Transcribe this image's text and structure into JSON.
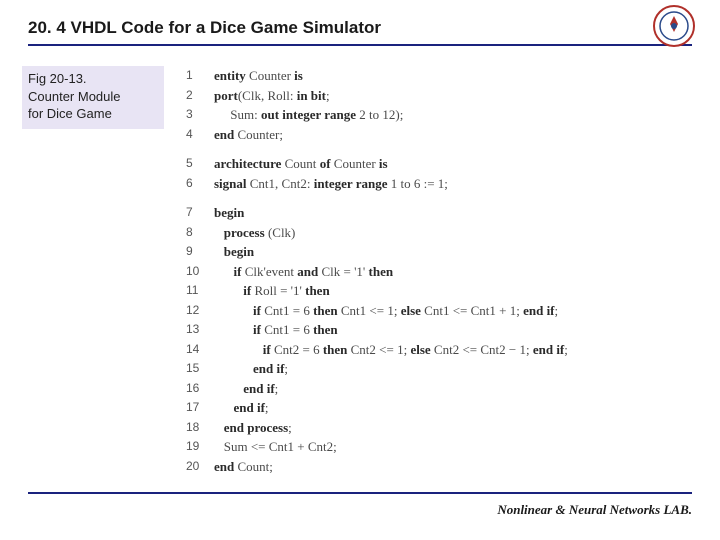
{
  "title": "20. 4 VHDL Code for a Dice Game Simulator",
  "caption": {
    "line1": "Fig 20-13.",
    "line2": "Counter Module",
    "line3": "for Dice Game"
  },
  "code": [
    {
      "n": "1",
      "segs": [
        {
          "t": "entity ",
          "b": true
        },
        {
          "t": "Counter "
        },
        {
          "t": "is",
          "b": true
        }
      ]
    },
    {
      "n": "2",
      "segs": [
        {
          "t": "port",
          "b": true
        },
        {
          "t": "(Clk, Roll: "
        },
        {
          "t": "in bit",
          "b": true
        },
        {
          "t": ";"
        }
      ]
    },
    {
      "n": "3",
      "segs": [
        {
          "t": "     Sum: "
        },
        {
          "t": "out integer range ",
          "b": true
        },
        {
          "t": "2 to 12);"
        }
      ]
    },
    {
      "n": "4",
      "segs": [
        {
          "t": "end ",
          "b": true
        },
        {
          "t": "Counter;"
        }
      ]
    },
    {
      "gap": true
    },
    {
      "n": "5",
      "segs": [
        {
          "t": "architecture ",
          "b": true
        },
        {
          "t": "Count "
        },
        {
          "t": "of ",
          "b": true
        },
        {
          "t": "Counter "
        },
        {
          "t": "is",
          "b": true
        }
      ]
    },
    {
      "n": "6",
      "segs": [
        {
          "t": "signal ",
          "b": true
        },
        {
          "t": "Cnt1, Cnt2: "
        },
        {
          "t": "integer range ",
          "b": true
        },
        {
          "t": "1 to 6 := 1;"
        }
      ]
    },
    {
      "gap": true
    },
    {
      "n": "7",
      "segs": [
        {
          "t": "begin",
          "b": true
        }
      ]
    },
    {
      "n": "8",
      "segs": [
        {
          "t": "   "
        },
        {
          "t": "process ",
          "b": true
        },
        {
          "t": "(Clk)"
        }
      ]
    },
    {
      "n": "9",
      "segs": [
        {
          "t": "   "
        },
        {
          "t": "begin",
          "b": true
        }
      ]
    },
    {
      "n": "10",
      "segs": [
        {
          "t": "      "
        },
        {
          "t": "if ",
          "b": true
        },
        {
          "t": "Clk'event "
        },
        {
          "t": "and ",
          "b": true
        },
        {
          "t": "Clk = '1' "
        },
        {
          "t": "then",
          "b": true
        }
      ]
    },
    {
      "n": "11",
      "segs": [
        {
          "t": "         "
        },
        {
          "t": "if ",
          "b": true
        },
        {
          "t": "Roll = '1' "
        },
        {
          "t": "then",
          "b": true
        }
      ]
    },
    {
      "n": "12",
      "segs": [
        {
          "t": "            "
        },
        {
          "t": "if ",
          "b": true
        },
        {
          "t": "Cnt1 = 6 "
        },
        {
          "t": "then ",
          "b": true
        },
        {
          "t": "Cnt1 <= 1; "
        },
        {
          "t": "else ",
          "b": true
        },
        {
          "t": "Cnt1 <= Cnt1 + 1; "
        },
        {
          "t": "end if",
          "b": true
        },
        {
          "t": ";"
        }
      ]
    },
    {
      "n": "13",
      "segs": [
        {
          "t": "            "
        },
        {
          "t": "if ",
          "b": true
        },
        {
          "t": "Cnt1 = 6 "
        },
        {
          "t": "then",
          "b": true
        }
      ]
    },
    {
      "n": "14",
      "segs": [
        {
          "t": "               "
        },
        {
          "t": "if ",
          "b": true
        },
        {
          "t": "Cnt2 = 6 "
        },
        {
          "t": "then ",
          "b": true
        },
        {
          "t": "Cnt2 <= 1; "
        },
        {
          "t": "else ",
          "b": true
        },
        {
          "t": "Cnt2 <= Cnt2 − 1; "
        },
        {
          "t": "end if",
          "b": true
        },
        {
          "t": ";"
        }
      ]
    },
    {
      "n": "15",
      "segs": [
        {
          "t": "            "
        },
        {
          "t": "end if",
          "b": true
        },
        {
          "t": ";"
        }
      ]
    },
    {
      "n": "16",
      "segs": [
        {
          "t": "         "
        },
        {
          "t": "end if",
          "b": true
        },
        {
          "t": ";"
        }
      ]
    },
    {
      "n": "17",
      "segs": [
        {
          "t": "      "
        },
        {
          "t": "end if",
          "b": true
        },
        {
          "t": ";"
        }
      ]
    },
    {
      "n": "18",
      "segs": [
        {
          "t": "   "
        },
        {
          "t": "end process",
          "b": true
        },
        {
          "t": ";"
        }
      ]
    },
    {
      "n": "19",
      "segs": [
        {
          "t": "   Sum <= Cnt1 + Cnt2;"
        }
      ]
    },
    {
      "n": "20",
      "segs": [
        {
          "t": "end ",
          "b": true
        },
        {
          "t": "Count;"
        }
      ]
    }
  ],
  "footer": "Nonlinear & Neural Networks LAB."
}
